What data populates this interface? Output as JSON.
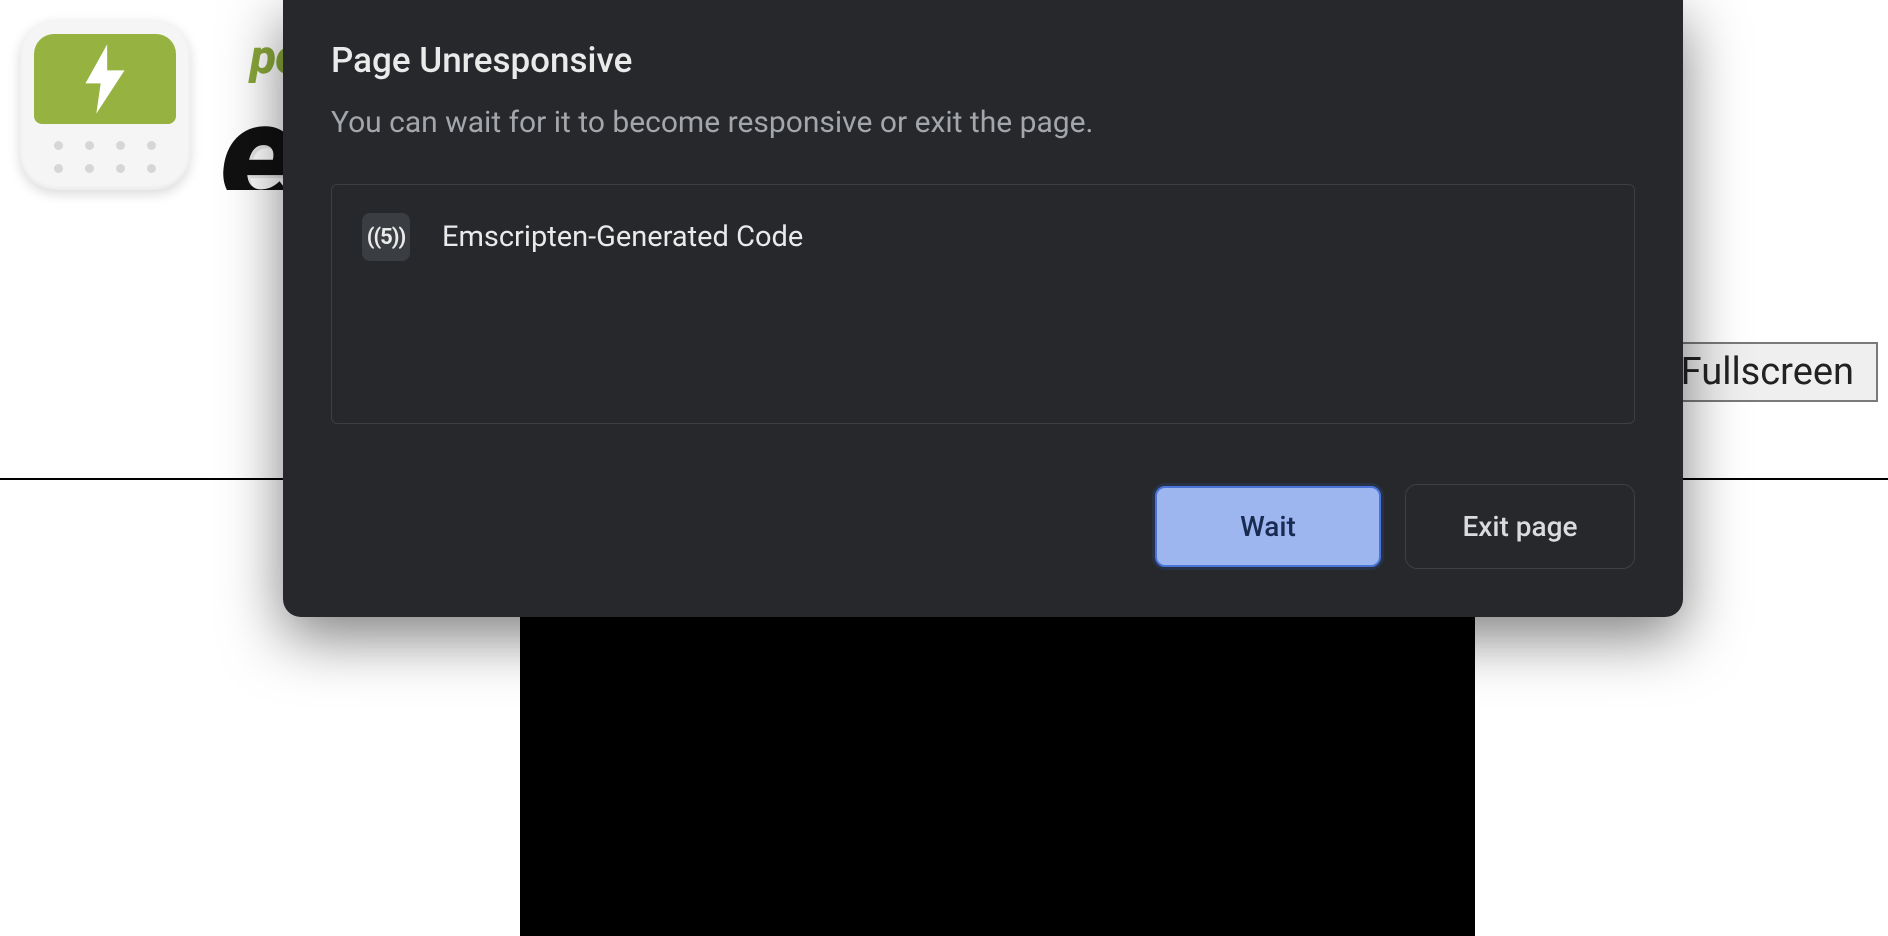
{
  "page": {
    "wordmark_small": "po",
    "wordmark_large": "en",
    "fullscreen_label": "Fullscreen"
  },
  "dialog": {
    "title": "Page Unresponsive",
    "subtitle": "You can wait for it to become responsive or exit the page.",
    "items": [
      {
        "favicon_text": "((5))",
        "label": "Emscripten-Generated Code"
      }
    ],
    "buttons": {
      "wait": "Wait",
      "exit": "Exit page"
    }
  }
}
